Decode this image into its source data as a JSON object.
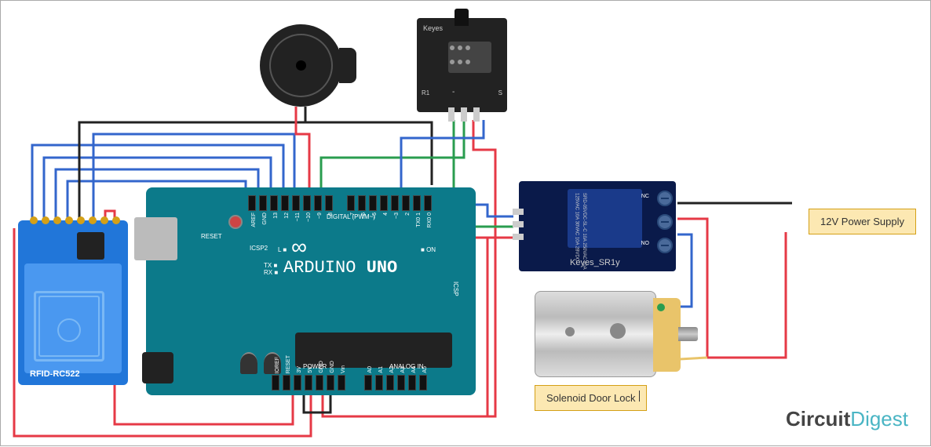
{
  "components": {
    "rfid": {
      "label": "RFID-RC522"
    },
    "arduino": {
      "name": "ARDUINO",
      "model": "UNO",
      "reset": "RESET",
      "digital_label": "DIGITAL (PWM~)",
      "tx": "TX",
      "rx": "RX",
      "on": "ON",
      "icsp": "ICSP",
      "icsp2": "ICSP2",
      "l": "L",
      "power": "POWER",
      "analog": "ANALOG IN",
      "top_pins": [
        "AREF",
        "GND",
        "13",
        "12",
        "~11",
        "~10",
        "~9",
        "8",
        "",
        "7",
        "~6",
        "~5",
        "4",
        "~3",
        "2",
        "TX0 1",
        "RX0 0"
      ],
      "bottom_pins": [
        "IOREF",
        "RESET",
        "3V",
        "5V",
        "GND",
        "GND",
        "Vin",
        "",
        "A0",
        "A1",
        "A2",
        "A3",
        "A4",
        "A5"
      ]
    },
    "hall": {
      "brand": "Keyes",
      "r1": "R1",
      "minus": "-",
      "s": "S"
    },
    "relay": {
      "label": "Keyes_SR1y",
      "cube": "SRD-05VDC-SL-C\n10A 250VAC 10A 125VAC\n10A 30VAC 10A 28VDC",
      "nc": "NC",
      "no": "NO"
    }
  },
  "labels": {
    "power_supply": "12V Power Supply",
    "solenoid": "Solenoid Door Lock"
  },
  "logo": {
    "text1": "Circuit",
    "text2": "Digest"
  },
  "connections": [
    {
      "from": "RFID-SDA",
      "to": "Arduino-D10",
      "color": "blue"
    },
    {
      "from": "RFID-SCK",
      "to": "Arduino-D13",
      "color": "blue"
    },
    {
      "from": "RFID-MOSI",
      "to": "Arduino-D11",
      "color": "blue"
    },
    {
      "from": "RFID-MISO",
      "to": "Arduino-D12",
      "color": "blue"
    },
    {
      "from": "RFID-RST",
      "to": "Arduino-D9",
      "color": "blue"
    },
    {
      "from": "RFID-GND",
      "to": "Arduino-GND",
      "color": "black"
    },
    {
      "from": "RFID-3.3V",
      "to": "Arduino-3V3",
      "color": "red"
    },
    {
      "from": "Buzzer+",
      "to": "Arduino",
      "color": "red"
    },
    {
      "from": "Buzzer-",
      "to": "Arduino-GND",
      "color": "black"
    },
    {
      "from": "Hall-S",
      "to": "Arduino-D2",
      "color": "blue"
    },
    {
      "from": "Hall-VCC",
      "to": "Arduino-5V",
      "color": "red"
    },
    {
      "from": "Hall-GND",
      "to": "Arduino-GND",
      "color": "green"
    },
    {
      "from": "Relay-IN",
      "to": "Arduino",
      "color": "blue"
    },
    {
      "from": "Relay-VCC",
      "to": "Arduino-5V",
      "color": "red"
    },
    {
      "from": "Relay-GND",
      "to": "Arduino-GND",
      "color": "green"
    },
    {
      "from": "Relay-COM",
      "to": "12V-PowerSupply+",
      "color": "red"
    },
    {
      "from": "Relay-NC",
      "to": "12V-PowerSupply-",
      "color": "black"
    },
    {
      "from": "Relay-NO",
      "to": "Solenoid",
      "color": "blue"
    },
    {
      "from": "Solenoid",
      "to": "12V-PowerSupply",
      "color": "red"
    }
  ]
}
